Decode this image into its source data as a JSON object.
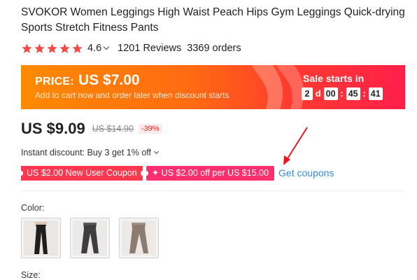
{
  "product": {
    "title": "SVOKOR Women Leggings High Waist Peach Hips Gym Leggings Quick-drying Sports Stretch Fitness Pants",
    "rating": "4.6",
    "reviews": "1201 Reviews",
    "orders": "3369 orders",
    "star_count": 5,
    "star_color": "#f44a44"
  },
  "banner": {
    "price_label": "PRICE:",
    "price_amount": "US $7.00",
    "subtext": "Add to cart now and order later when discount starts",
    "sale_title": "Sale starts in",
    "countdown": {
      "days": "2",
      "day_unit": "d",
      "hours": "00",
      "minutes": "45",
      "seconds": "41",
      "sep": ":"
    }
  },
  "price": {
    "current": "US $9.09",
    "original": "US $14.90",
    "discount": "-39%"
  },
  "instant_discount": "Instant discount: Buy 3 get 1% off",
  "coupons": {
    "items": [
      "US $2.00 New User Coupon",
      "✦ US $2.00 off per US $15.00"
    ],
    "get_label": "Get coupons"
  },
  "color": {
    "label": "Color:",
    "swatches": [
      "black leggings",
      "dark grey leggings",
      "taupe leggings"
    ]
  },
  "size": {
    "label": "Size:"
  },
  "annotation": {
    "arrow_color": "#e8181e"
  }
}
